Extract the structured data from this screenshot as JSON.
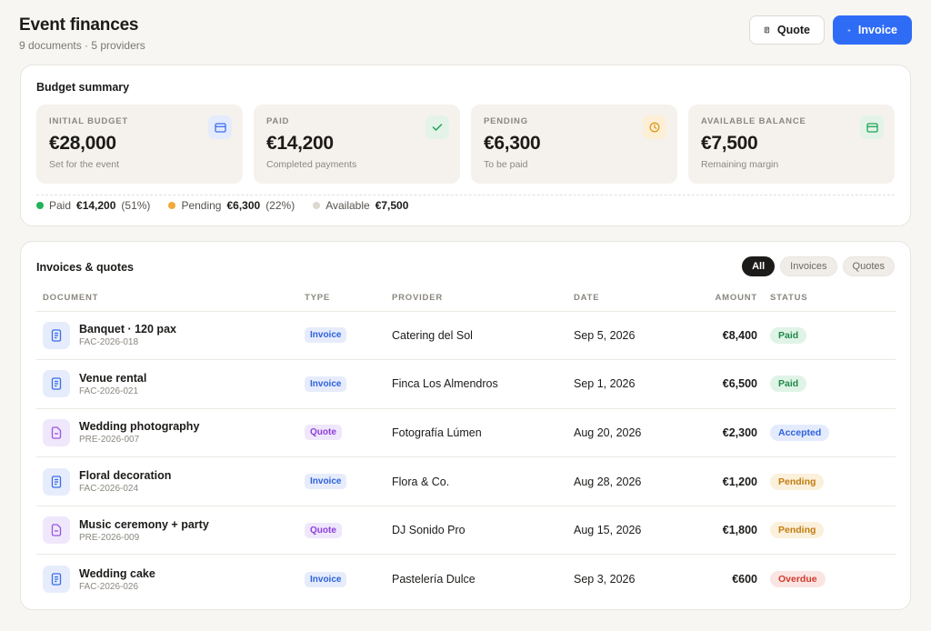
{
  "header": {
    "title": "Event finances",
    "subtitle": "9 documents · 5 providers",
    "quote_label": "Quote",
    "invoice_label": "Invoice"
  },
  "budget": {
    "title": "Budget summary",
    "stats": [
      {
        "label": "Initial budget",
        "value": "€28,000",
        "hint": "Set for the event",
        "icon": "card-icon"
      },
      {
        "label": "Paid",
        "value": "€14,200",
        "hint": "Completed payments",
        "icon": "check-icon"
      },
      {
        "label": "Pending",
        "value": "€6,300",
        "hint": "To be paid",
        "icon": "clock-icon"
      },
      {
        "label": "Available balance",
        "value": "€7,500",
        "hint": "Remaining margin",
        "icon": "wallet-icon"
      }
    ],
    "legend": [
      {
        "label": "Paid",
        "amount": "€14,200",
        "pct": "(51%)",
        "color": "#22b35a"
      },
      {
        "label": "Pending",
        "amount": "€6,300",
        "pct": "(22%)",
        "color": "#f0a93b"
      },
      {
        "label": "Available",
        "amount": "€7,500",
        "pct": "",
        "color": "#dcd8d0"
      }
    ]
  },
  "invoices": {
    "title": "Invoices & quotes",
    "filters": [
      "All",
      "Invoices",
      "Quotes"
    ],
    "columns": [
      "Document",
      "Type",
      "Provider",
      "Date",
      "Amount",
      "Status"
    ],
    "rows": [
      {
        "name": "Banquet · 120 pax",
        "code": "FAC-2026-018",
        "type": "Invoice",
        "provider": "Catering del Sol",
        "date": "Sep 5, 2026",
        "amount": "€8,400",
        "status": "Paid"
      },
      {
        "name": "Venue rental",
        "code": "FAC-2026-021",
        "type": "Invoice",
        "provider": "Finca Los Almendros",
        "date": "Sep 1, 2026",
        "amount": "€6,500",
        "status": "Paid"
      },
      {
        "name": "Wedding photography",
        "code": "PRE-2026-007",
        "type": "Quote",
        "provider": "Fotografía Lúmen",
        "date": "Aug 20, 2026",
        "amount": "€2,300",
        "status": "Accepted"
      },
      {
        "name": "Floral decoration",
        "code": "FAC-2026-024",
        "type": "Invoice",
        "provider": "Flora & Co.",
        "date": "Aug 28, 2026",
        "amount": "€1,200",
        "status": "Pending"
      },
      {
        "name": "Music ceremony + party",
        "code": "PRE-2026-009",
        "type": "Quote",
        "provider": "DJ Sonido Pro",
        "date": "Aug 15, 2026",
        "amount": "€1,800",
        "status": "Pending"
      },
      {
        "name": "Wedding cake",
        "code": "FAC-2026-026",
        "type": "Invoice",
        "provider": "Pastelería Dulce",
        "date": "Sep 3, 2026",
        "amount": "€600",
        "status": "Overdue"
      }
    ]
  }
}
